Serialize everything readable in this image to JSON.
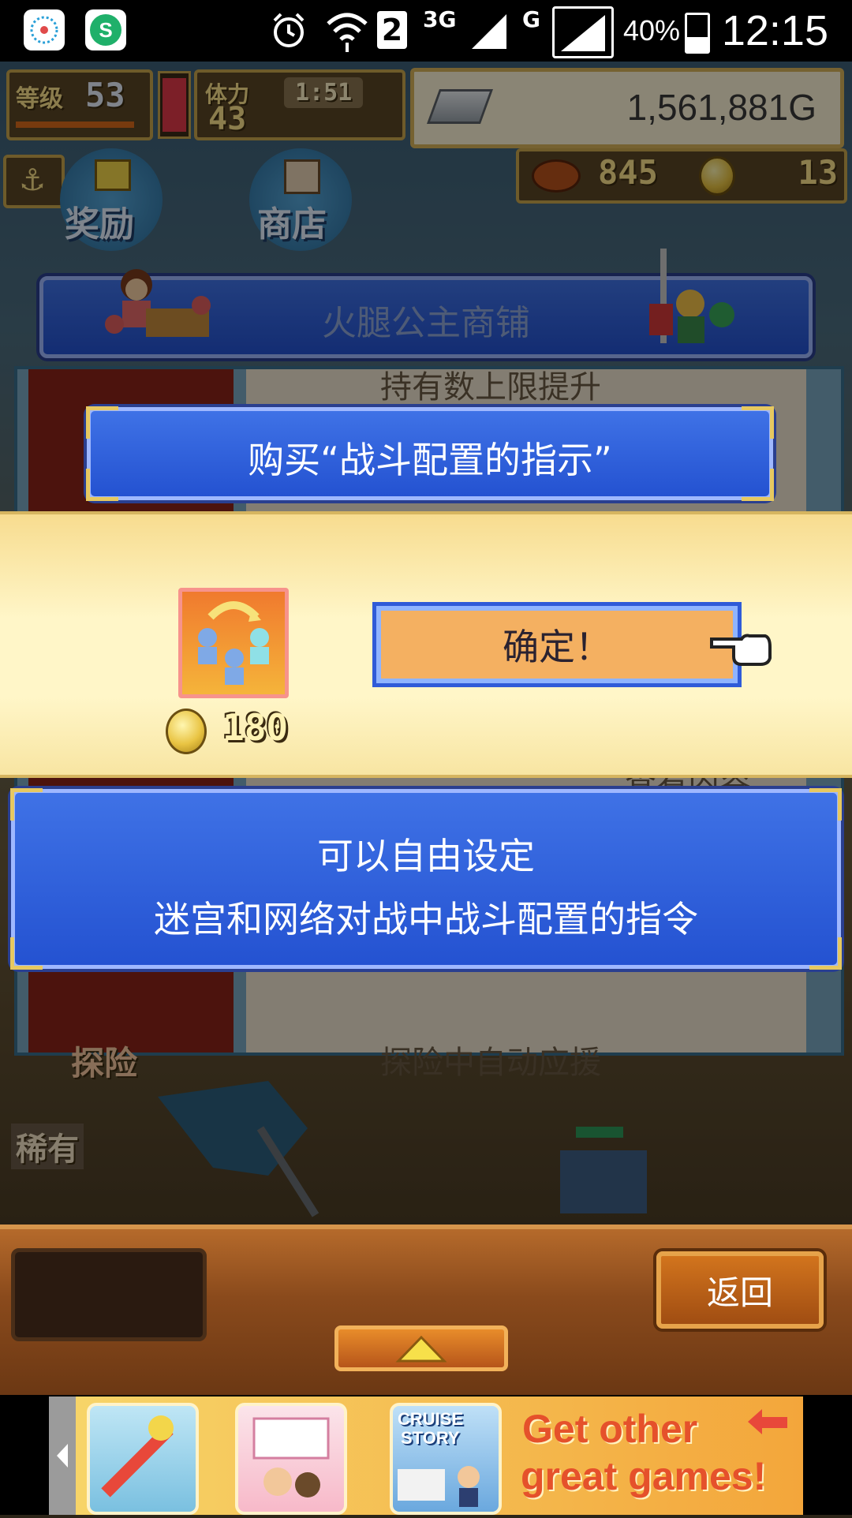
{
  "status_bar": {
    "time": "12:15",
    "battery_percent": "40%",
    "battery_level": 0.4,
    "network_sim_label": "2",
    "network_3g": "3G",
    "network_g": "G",
    "icons": [
      "app-icon-1",
      "360-security-icon",
      "alarm-icon",
      "wifi-icon",
      "sim-2-icon",
      "signal-3g-icon",
      "signal-g-icon",
      "signal-full-icon",
      "battery-icon"
    ]
  },
  "hud": {
    "level_label": "等级",
    "level_value": "53",
    "stamina_label": "体力",
    "stamina_value": "43",
    "timer": "1:51",
    "gold": "1,561,881G",
    "food_count": "845",
    "coin_count": "13"
  },
  "nav": {
    "reward_label": "奖励",
    "shop_label": "商店"
  },
  "shop": {
    "title": "火腿公主商铺",
    "partial_item_top": "持有数上限提升",
    "partial_item_mid": "查看内容",
    "partial_item_bottom": "探险中自动应援",
    "side_label_bottom": "探险",
    "rarity_label": "稀有"
  },
  "purchase_dialog": {
    "title": "购买“战斗配置的指示”",
    "confirm_label": "确定！",
    "price": "180",
    "description_line1": "可以自由设定",
    "description_line2": "迷宫和网络对战中战斗配置的指令"
  },
  "bottom": {
    "back_label": "返回"
  },
  "ad": {
    "game3_title_line1": "CRUISE",
    "game3_title_line2": "STORY",
    "cta_line1": "Get other",
    "cta_line2": "great games!"
  }
}
